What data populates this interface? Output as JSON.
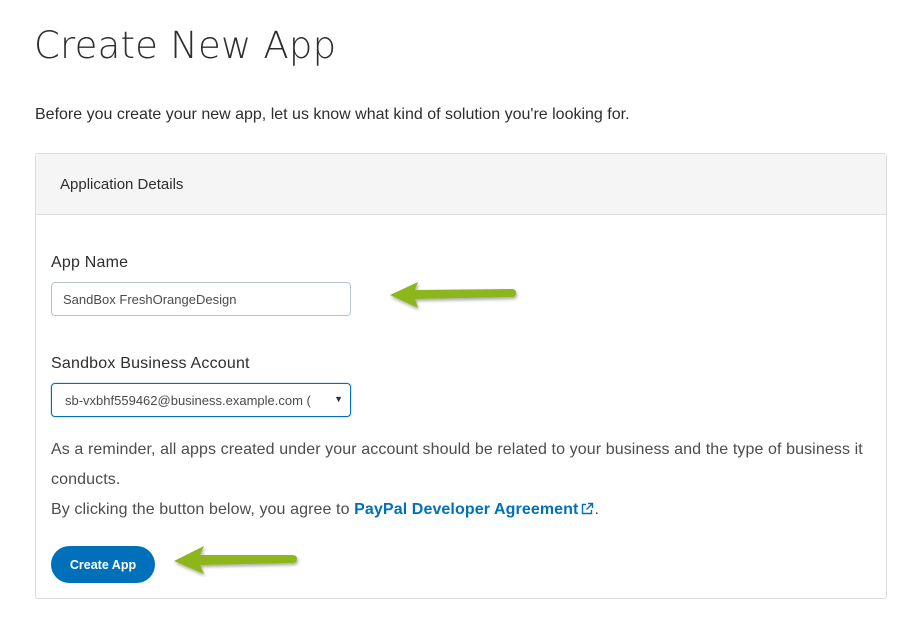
{
  "page": {
    "title": "Create New App",
    "intro": "Before you create your new app, let us know what kind of solution you're looking for."
  },
  "panel": {
    "header": "Application Details",
    "app_name": {
      "label": "App Name",
      "value": "SandBox FreshOrangeDesign"
    },
    "business_account": {
      "label": "Sandbox Business Account",
      "selected": "sb-vxbhf559462@business.example.com ("
    },
    "reminder": "As a reminder, all apps created under your account should be related to your business and the type of business it conducts.",
    "agreement_prefix": "By clicking the button below, you agree to ",
    "agreement_link": "PayPal Developer Agreement",
    "agreement_suffix": ".",
    "create_button": "Create App"
  },
  "colors": {
    "accent": "#0070ba",
    "annotation_arrow": "#8db51e"
  },
  "icons": {
    "external_link": "external-link-icon",
    "dropdown": "dropdown-arrow-icon",
    "annotation": "green-arrow-icon"
  }
}
